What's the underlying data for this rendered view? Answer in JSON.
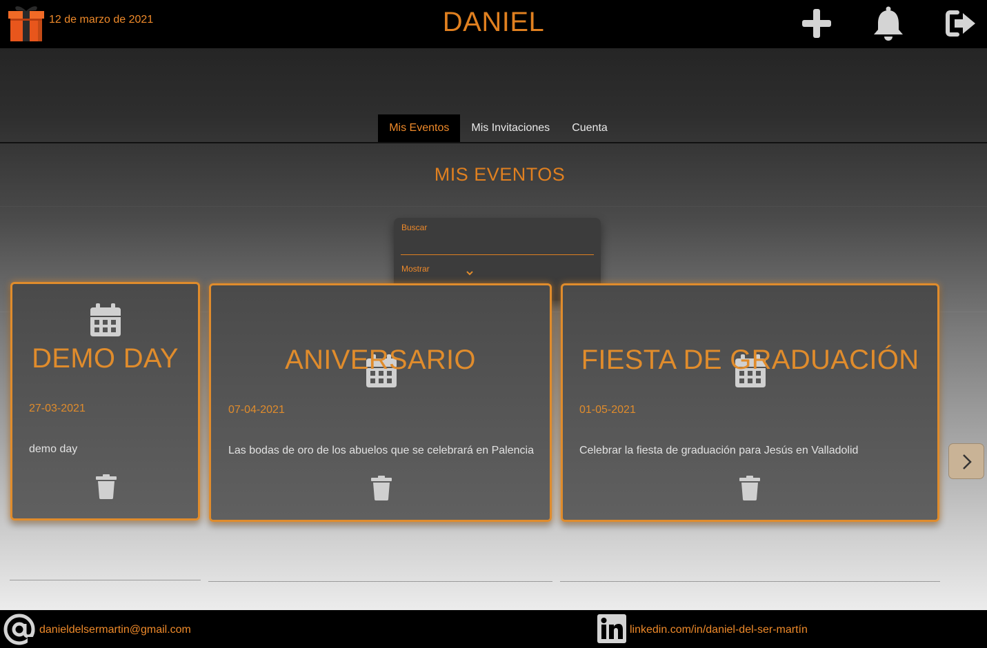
{
  "header": {
    "date": "12 de marzo de 2021",
    "title": "DANIEL",
    "icons": {
      "logo": "gift-icon",
      "add": "plus-icon",
      "notifications": "bell-icon",
      "logout": "logout-icon"
    }
  },
  "tabs": [
    {
      "label": "Mis Eventos",
      "active": true
    },
    {
      "label": "Mis Invitaciones",
      "active": false
    },
    {
      "label": "Cuenta",
      "active": false
    }
  ],
  "section": {
    "title": "MIS EVENTOS"
  },
  "filter": {
    "search_label": "Buscar",
    "search_value": "",
    "show_label": "Mostrar",
    "show_value": ""
  },
  "events": [
    {
      "title": "DEMO DAY",
      "date": "27-03-2021",
      "description": "demo day"
    },
    {
      "title": "ANIVERSARIO",
      "date": "07-04-2021",
      "description": "Las bodas de oro de los abuelos que se celebrará en Palencia"
    },
    {
      "title": "FIESTA DE GRADUACIÓN",
      "date": "01-05-2021",
      "description": "Celebrar la fiesta de graduación para Jesús en Valladolid"
    }
  ],
  "footer": {
    "email": "danieldelsermartin@gmail.com",
    "linkedin": "linkedin.com/in/daniel-del-ser-martín"
  },
  "colors": {
    "accent": "#e08c2c",
    "header_bg": "#000000",
    "card_border": "#e08c2c",
    "icon_gray": "#d0d0d0",
    "next_button_bg": "#c9b396"
  }
}
